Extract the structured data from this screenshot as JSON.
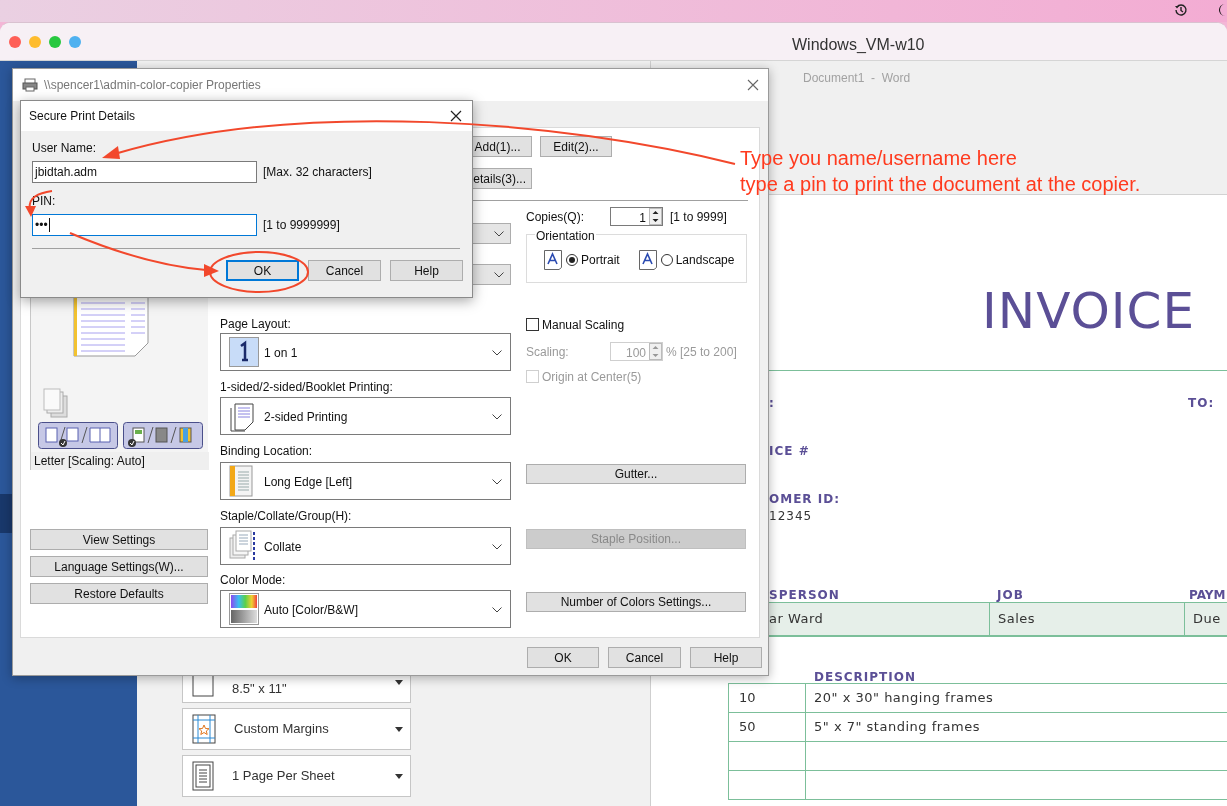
{
  "vm_window": {
    "title": "Windows_VM-w10"
  },
  "word": {
    "title": "Document1  -  Word",
    "sidebar_items": [
      {
        "selected": true
      }
    ],
    "print_settings": [
      {
        "kind": "paper",
        "detail": "8.5\" x 11\""
      },
      {
        "kind": "margins",
        "label": "Custom Margins"
      },
      {
        "kind": "pages",
        "label": "1 Page Per Sheet"
      }
    ],
    "invoice": {
      "heading": "INVOICE",
      "labels": [
        {
          "kind": "left",
          "text": ":"
        },
        {
          "kind": "right",
          "text": "TO:"
        },
        {
          "kind": "left",
          "text": "ICE #"
        },
        {
          "kind": "left",
          "text": "OMER ID:"
        }
      ],
      "customer_id": "12345",
      "job_columns": [
        "SPERSON",
        "JOB",
        "PAYM"
      ],
      "job_row": [
        "ar Ward",
        "Sales",
        "Due"
      ],
      "items_column": "DESCRIPTION",
      "items": [
        {
          "kind": "line",
          "qty": "10",
          "description": "20\" x 30\" hanging frames"
        },
        {
          "kind": "line",
          "qty": "50",
          "description": "5\" x 7\" standing frames"
        },
        {
          "kind": "blank"
        },
        {
          "kind": "blank"
        }
      ]
    }
  },
  "properties_dialog": {
    "title": "\\\\spencer1\\admin-color-copier Properties",
    "top_buttons": [
      "Add(1)...",
      "Edit(2)...",
      "etails(3)..."
    ],
    "preview_caption": "Letter [Scaling: Auto]",
    "left_buttons": [
      "View Settings",
      "Language Settings(W)...",
      "Restore Defaults"
    ],
    "settings": [
      {
        "kind": "layout",
        "label": "Page Layout:",
        "value": "1 on 1"
      },
      {
        "kind": "duplex",
        "label": "1-sided/2-sided/Booklet Printing:",
        "value": "2-sided Printing"
      },
      {
        "kind": "binding",
        "label": "Binding Location:",
        "value": "Long Edge [Left]"
      },
      {
        "kind": "collate",
        "label": "Staple/Collate/Group(H):",
        "value": "Collate"
      },
      {
        "kind": "color",
        "label": "Color Mode:",
        "value": "Auto [Color/B&W]"
      }
    ],
    "copies": {
      "label": "Copies(Q):",
      "value": "1",
      "range": "[1 to 9999]"
    },
    "orientation": {
      "label": "Orientation",
      "options": [
        {
          "label": "Portrait",
          "selected": true
        },
        {
          "label": "Landscape",
          "selected": false
        }
      ]
    },
    "manual_scaling": {
      "label": "Manual Scaling",
      "checked": false
    },
    "scaling": {
      "label": "Scaling:",
      "value": "100",
      "range": "% [25 to 200]",
      "disabled": true
    },
    "origin": {
      "label": "Origin at Center(5)",
      "checked": false,
      "disabled": true
    },
    "side_buttons": [
      {
        "label": "Gutter...",
        "disabled": false
      },
      {
        "label": "Staple Position...",
        "disabled": true
      },
      {
        "label": "Number of Colors Settings...",
        "disabled": false
      }
    ],
    "buttons": [
      "OK",
      "Cancel",
      "Help"
    ]
  },
  "secure_dialog": {
    "title": "Secure Print Details",
    "fields": [
      {
        "label": "User Name:",
        "value": "jbidtah.adm",
        "hint": "[Max. 32 characters]",
        "focused": false
      },
      {
        "label": "PIN:",
        "value": "•••",
        "hint": "[1 to 9999999]",
        "focused": true
      }
    ],
    "buttons": [
      {
        "label": "OK",
        "default": true
      },
      {
        "label": "Cancel",
        "default": false
      },
      {
        "label": "Help",
        "default": false
      }
    ]
  },
  "annotation": {
    "lines": [
      "Type you name/username here",
      "type a pin to print the document at the copier."
    ]
  }
}
